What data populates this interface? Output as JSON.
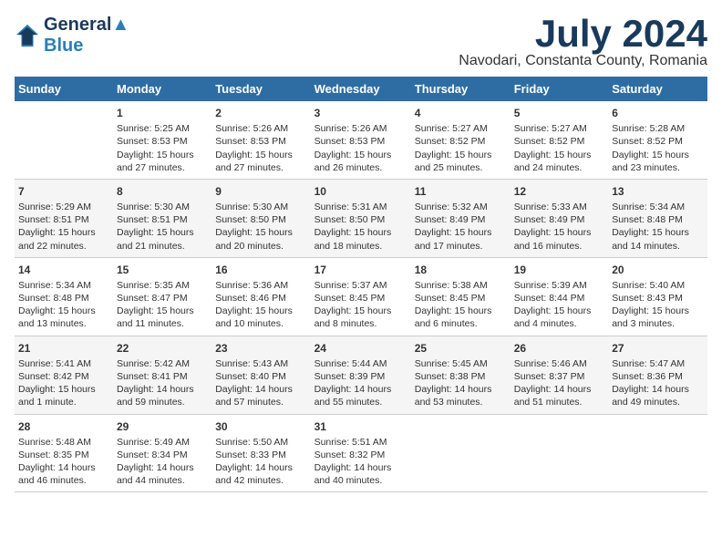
{
  "logo": {
    "line1": "General",
    "line2": "Blue"
  },
  "title": "July 2024",
  "subtitle": "Navodari, Constanta County, Romania",
  "days_header": [
    "Sunday",
    "Monday",
    "Tuesday",
    "Wednesday",
    "Thursday",
    "Friday",
    "Saturday"
  ],
  "weeks": [
    [
      {
        "day": "",
        "info": ""
      },
      {
        "day": "1",
        "info": "Sunrise: 5:25 AM\nSunset: 8:53 PM\nDaylight: 15 hours\nand 27 minutes."
      },
      {
        "day": "2",
        "info": "Sunrise: 5:26 AM\nSunset: 8:53 PM\nDaylight: 15 hours\nand 27 minutes."
      },
      {
        "day": "3",
        "info": "Sunrise: 5:26 AM\nSunset: 8:53 PM\nDaylight: 15 hours\nand 26 minutes."
      },
      {
        "day": "4",
        "info": "Sunrise: 5:27 AM\nSunset: 8:52 PM\nDaylight: 15 hours\nand 25 minutes."
      },
      {
        "day": "5",
        "info": "Sunrise: 5:27 AM\nSunset: 8:52 PM\nDaylight: 15 hours\nand 24 minutes."
      },
      {
        "day": "6",
        "info": "Sunrise: 5:28 AM\nSunset: 8:52 PM\nDaylight: 15 hours\nand 23 minutes."
      }
    ],
    [
      {
        "day": "7",
        "info": "Sunrise: 5:29 AM\nSunset: 8:51 PM\nDaylight: 15 hours\nand 22 minutes."
      },
      {
        "day": "8",
        "info": "Sunrise: 5:30 AM\nSunset: 8:51 PM\nDaylight: 15 hours\nand 21 minutes."
      },
      {
        "day": "9",
        "info": "Sunrise: 5:30 AM\nSunset: 8:50 PM\nDaylight: 15 hours\nand 20 minutes."
      },
      {
        "day": "10",
        "info": "Sunrise: 5:31 AM\nSunset: 8:50 PM\nDaylight: 15 hours\nand 18 minutes."
      },
      {
        "day": "11",
        "info": "Sunrise: 5:32 AM\nSunset: 8:49 PM\nDaylight: 15 hours\nand 17 minutes."
      },
      {
        "day": "12",
        "info": "Sunrise: 5:33 AM\nSunset: 8:49 PM\nDaylight: 15 hours\nand 16 minutes."
      },
      {
        "day": "13",
        "info": "Sunrise: 5:34 AM\nSunset: 8:48 PM\nDaylight: 15 hours\nand 14 minutes."
      }
    ],
    [
      {
        "day": "14",
        "info": "Sunrise: 5:34 AM\nSunset: 8:48 PM\nDaylight: 15 hours\nand 13 minutes."
      },
      {
        "day": "15",
        "info": "Sunrise: 5:35 AM\nSunset: 8:47 PM\nDaylight: 15 hours\nand 11 minutes."
      },
      {
        "day": "16",
        "info": "Sunrise: 5:36 AM\nSunset: 8:46 PM\nDaylight: 15 hours\nand 10 minutes."
      },
      {
        "day": "17",
        "info": "Sunrise: 5:37 AM\nSunset: 8:45 PM\nDaylight: 15 hours\nand 8 minutes."
      },
      {
        "day": "18",
        "info": "Sunrise: 5:38 AM\nSunset: 8:45 PM\nDaylight: 15 hours\nand 6 minutes."
      },
      {
        "day": "19",
        "info": "Sunrise: 5:39 AM\nSunset: 8:44 PM\nDaylight: 15 hours\nand 4 minutes."
      },
      {
        "day": "20",
        "info": "Sunrise: 5:40 AM\nSunset: 8:43 PM\nDaylight: 15 hours\nand 3 minutes."
      }
    ],
    [
      {
        "day": "21",
        "info": "Sunrise: 5:41 AM\nSunset: 8:42 PM\nDaylight: 15 hours\nand 1 minute."
      },
      {
        "day": "22",
        "info": "Sunrise: 5:42 AM\nSunset: 8:41 PM\nDaylight: 14 hours\nand 59 minutes."
      },
      {
        "day": "23",
        "info": "Sunrise: 5:43 AM\nSunset: 8:40 PM\nDaylight: 14 hours\nand 57 minutes."
      },
      {
        "day": "24",
        "info": "Sunrise: 5:44 AM\nSunset: 8:39 PM\nDaylight: 14 hours\nand 55 minutes."
      },
      {
        "day": "25",
        "info": "Sunrise: 5:45 AM\nSunset: 8:38 PM\nDaylight: 14 hours\nand 53 minutes."
      },
      {
        "day": "26",
        "info": "Sunrise: 5:46 AM\nSunset: 8:37 PM\nDaylight: 14 hours\nand 51 minutes."
      },
      {
        "day": "27",
        "info": "Sunrise: 5:47 AM\nSunset: 8:36 PM\nDaylight: 14 hours\nand 49 minutes."
      }
    ],
    [
      {
        "day": "28",
        "info": "Sunrise: 5:48 AM\nSunset: 8:35 PM\nDaylight: 14 hours\nand 46 minutes."
      },
      {
        "day": "29",
        "info": "Sunrise: 5:49 AM\nSunset: 8:34 PM\nDaylight: 14 hours\nand 44 minutes."
      },
      {
        "day": "30",
        "info": "Sunrise: 5:50 AM\nSunset: 8:33 PM\nDaylight: 14 hours\nand 42 minutes."
      },
      {
        "day": "31",
        "info": "Sunrise: 5:51 AM\nSunset: 8:32 PM\nDaylight: 14 hours\nand 40 minutes."
      },
      {
        "day": "",
        "info": ""
      },
      {
        "day": "",
        "info": ""
      },
      {
        "day": "",
        "info": ""
      }
    ]
  ]
}
